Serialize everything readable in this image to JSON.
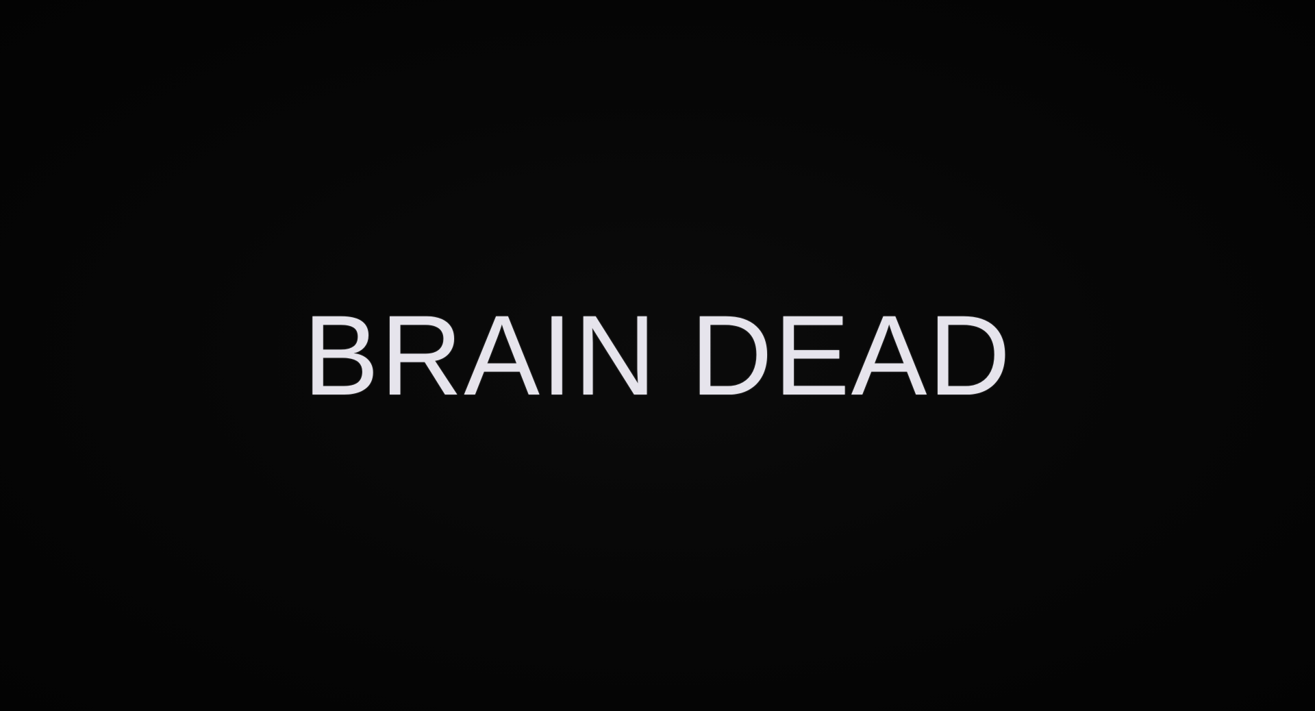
{
  "title_card": {
    "text": "BRAIN DEAD"
  },
  "colors": {
    "background": "#050505",
    "text": "#e6e4ec"
  }
}
